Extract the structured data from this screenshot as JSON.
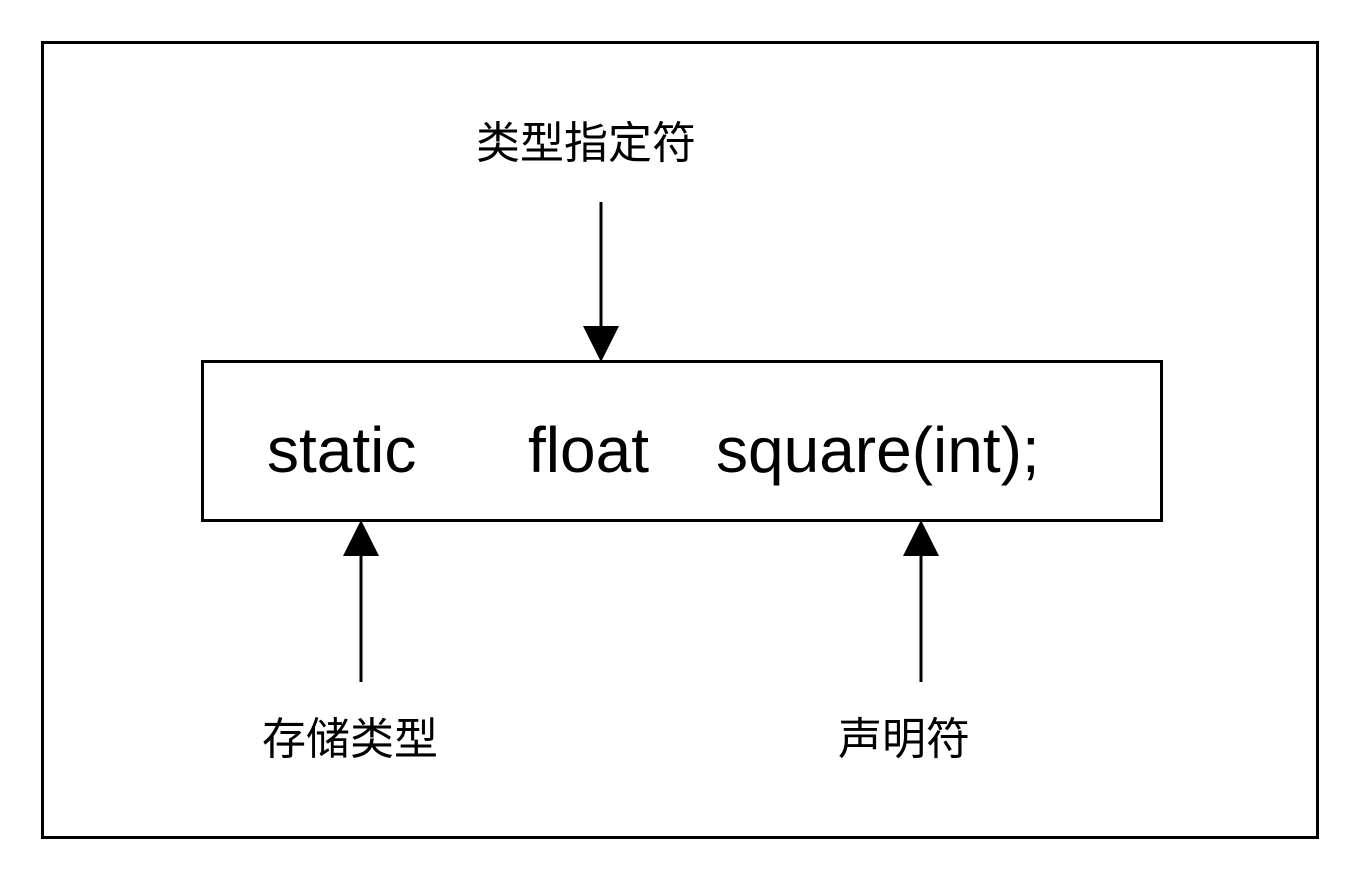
{
  "code": {
    "storage_token": "static",
    "type_token": "float",
    "declarator_token": "square(int);"
  },
  "labels": {
    "type_specifier": "类型指定符",
    "storage_class": "存储类型",
    "declarator": "声明符"
  },
  "colors": {
    "stroke": "#000000",
    "background": "#ffffff"
  }
}
